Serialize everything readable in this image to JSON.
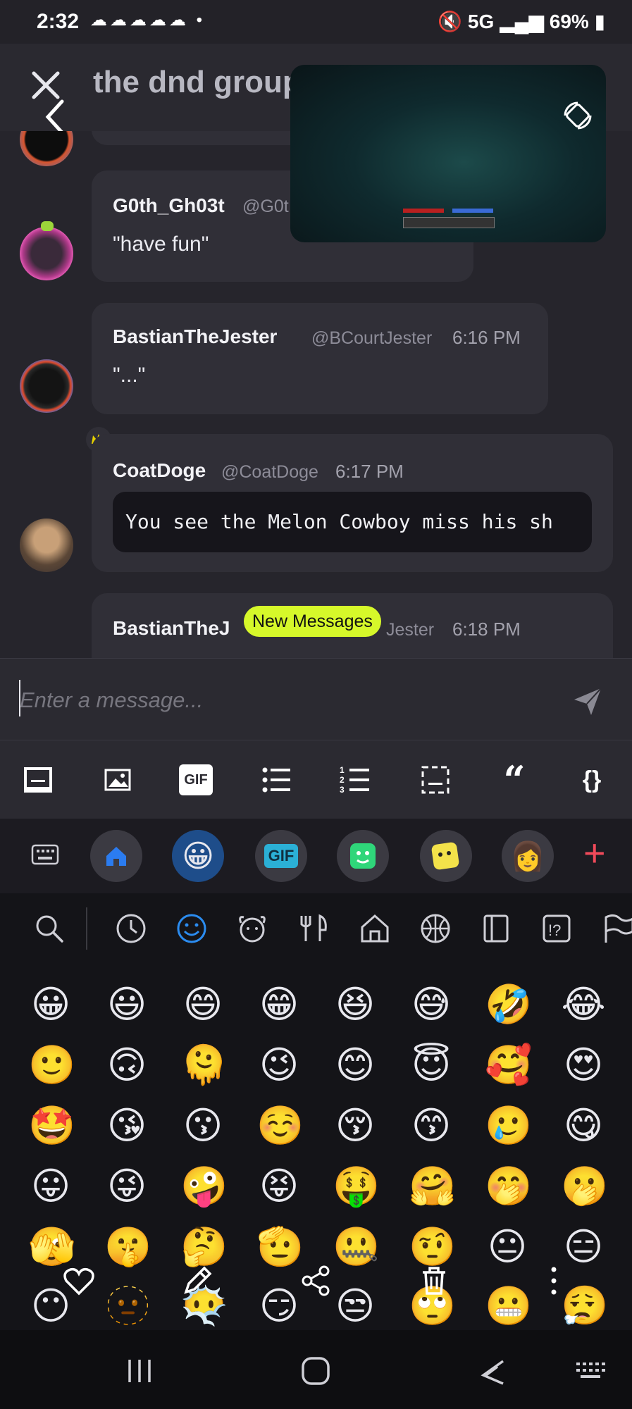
{
  "status_bar": {
    "time": "2:32",
    "notification_icons": "☁☁☁☁☁ •",
    "network": "5G",
    "battery": "69%"
  },
  "header": {
    "channel_title": "the dnd group"
  },
  "messages": [
    {
      "author": "G0th_Gh03t",
      "handle": "@G0t",
      "text": "\"have fun\""
    },
    {
      "author": "BastianTheJester",
      "handle": "@BCourtJester",
      "time": "6:16 PM",
      "text": "\"...\""
    },
    {
      "author": "CoatDoge",
      "handle": "@CoatDoge",
      "time": "6:17 PM",
      "code": "You see the Melon Cowboy miss his sh"
    },
    {
      "author": "BastianTheJ",
      "handle": "Jester",
      "time": "6:18 PM"
    }
  ],
  "new_messages_label": "New Messages",
  "composer": {
    "placeholder": "Enter a message..."
  },
  "format_toolbar": {
    "gif_label": "GIF",
    "quote_label": "“",
    "code_label": "{}"
  },
  "keyboard_toolbar": {
    "gif_label": "GIF",
    "add_label": "+"
  },
  "emoji_rows": [
    [
      "😀",
      "😃",
      "😄",
      "😁",
      "😆",
      "😅",
      "🤣",
      "😂"
    ],
    [
      "🙂",
      "🙃",
      "🫠",
      "😉",
      "😊",
      "😇",
      "🥰",
      "😍"
    ],
    [
      "🤩",
      "😘",
      "😗",
      "☺️",
      "😚",
      "😙",
      "🥲",
      "😋"
    ],
    [
      "😛",
      "😜",
      "🤪",
      "😝",
      "🤑",
      "🤗",
      "🤭",
      "🫢"
    ],
    [
      "🫣",
      "🤫",
      "🤔",
      "🫡",
      "🤐",
      "🤨",
      "😐",
      "😑"
    ],
    [
      "😶",
      "🫥",
      "😶‍🌫️",
      "😏",
      "😒",
      "🙄",
      "😬",
      "😮‍💨"
    ]
  ]
}
